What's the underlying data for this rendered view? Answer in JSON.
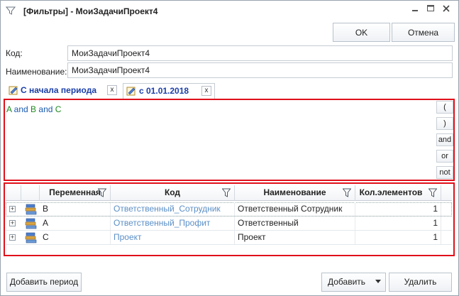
{
  "window": {
    "title": "[Фильтры] - МоиЗадачиПроект4",
    "ok_label": "OK",
    "cancel_label": "Отмена"
  },
  "form": {
    "code_label": "Код:",
    "code_value": "МоиЗадачиПроект4",
    "name_label": "Наименование:",
    "name_value": "МоиЗадачиПроект4"
  },
  "tabs": [
    {
      "label": "С начала периода",
      "close": "x"
    },
    {
      "label": "с 01.01.2018",
      "close": "x"
    }
  ],
  "expression": {
    "parts": [
      "A",
      " and ",
      "B",
      " and ",
      "C"
    ]
  },
  "operators": [
    "(",
    ")",
    "and",
    "or",
    "not"
  ],
  "grid": {
    "columns": [
      "Переменная",
      "Код",
      "Наименование",
      "Кол.элементов"
    ],
    "rows": [
      {
        "expander": "+",
        "variable": "B",
        "code": "Ответственный_Сотрудник",
        "name": "Ответственный Сотрудник",
        "count": "1"
      },
      {
        "expander": "+",
        "variable": "A",
        "code": "Ответственный_Профит",
        "name": "Ответственный",
        "count": "1"
      },
      {
        "expander": "+",
        "variable": "C",
        "code": "Проект",
        "name": "Проект",
        "count": "1"
      }
    ]
  },
  "footer": {
    "add_period_label": "Добавить период",
    "add_label": "Добавить",
    "delete_label": "Удалить"
  },
  "colors": {
    "highlight_border": "#e0101a",
    "tab_text": "#1a3ea8",
    "operator_text": "#1a5ab0",
    "variable_text": "#1e8a1e",
    "code_link": "#5b8fc7"
  }
}
